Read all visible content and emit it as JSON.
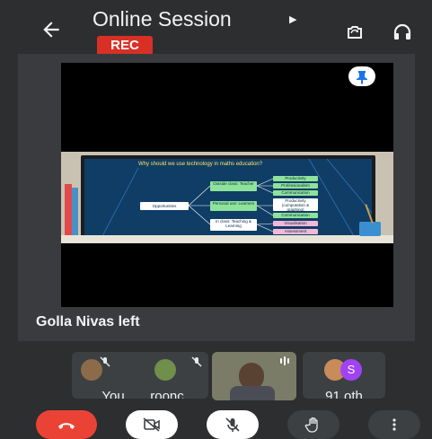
{
  "header": {
    "title": "Online Session",
    "recording_badge": "REC"
  },
  "stage": {
    "slide": {
      "title": "Why should we use technology in maths education?",
      "root": "Opportunities",
      "branches": [
        "Outside class: Teacher",
        "Personal use: Learners",
        "In class: Teaching & Learning"
      ],
      "leaves": [
        "Productivity",
        "Professionalism",
        "Communication",
        "Productivity (computation & graphing)",
        "Communication",
        "Visualisation",
        "Assessment"
      ]
    }
  },
  "notification": "Golla Nivas left",
  "participants": [
    {
      "label": "You",
      "mic": "muted"
    },
    {
      "label": "roonc",
      "mic": "muted"
    },
    {
      "label": "",
      "mic": "speaking"
    },
    {
      "label": "91 oth",
      "avatar_letter": "S"
    }
  ],
  "controls": [
    "end-call",
    "camera-off",
    "mic-off",
    "raise-hand",
    "more-options"
  ],
  "colors": {
    "end_call": "#ea4335",
    "rec": "#d93025",
    "avatar_s": "#a142f4",
    "background": "#2d2e30"
  }
}
